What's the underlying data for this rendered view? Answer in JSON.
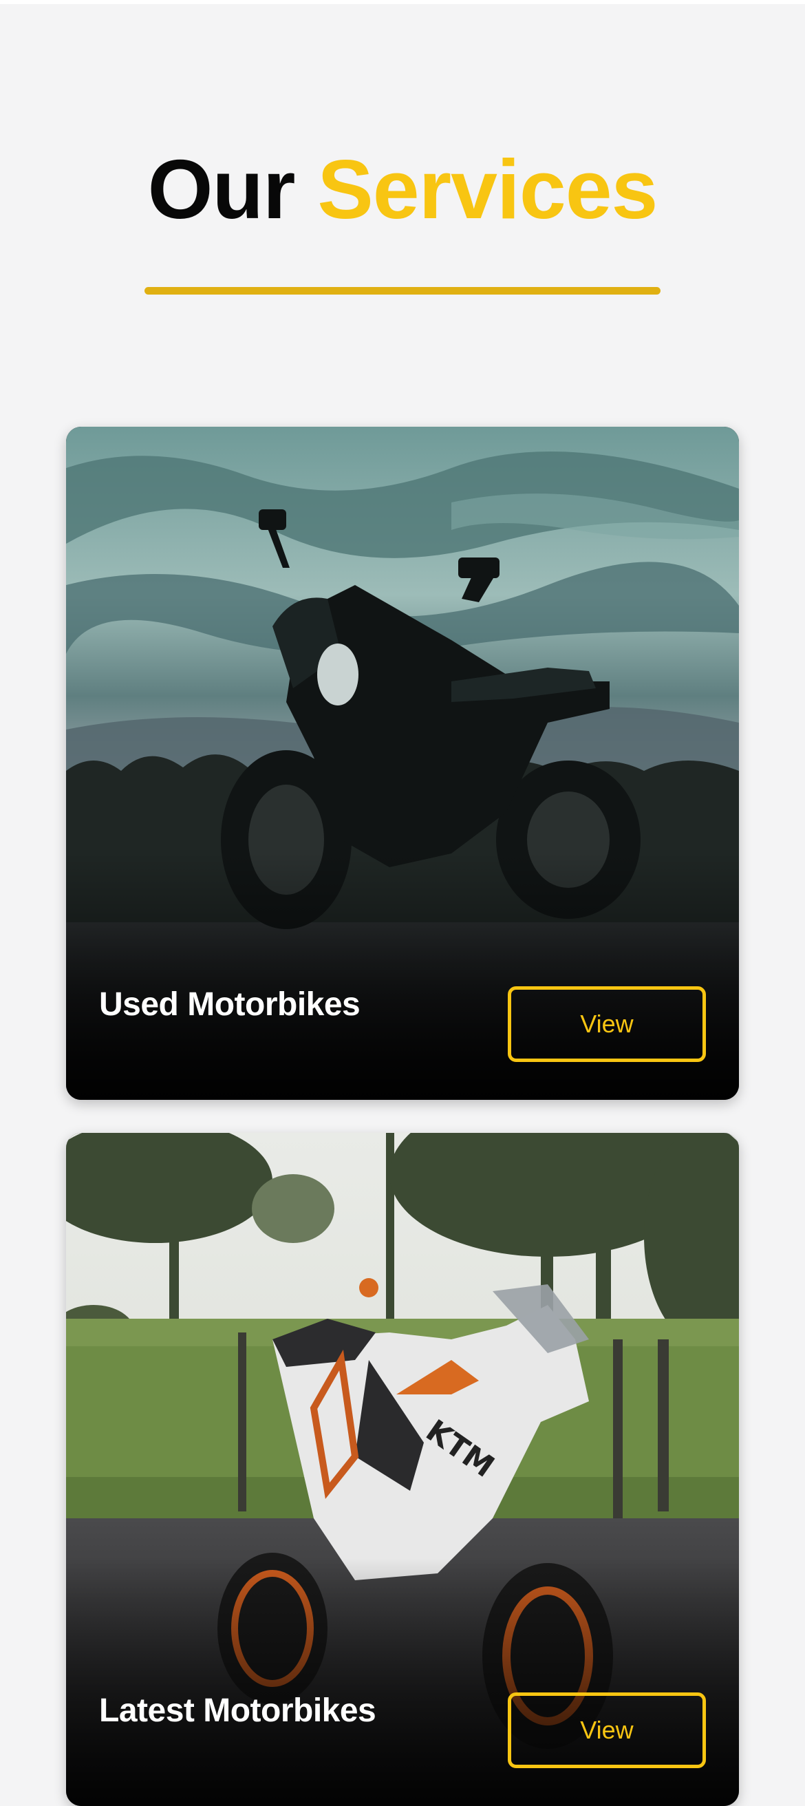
{
  "header": {
    "title_part1": "Our",
    "title_part2": "Services"
  },
  "services": [
    {
      "title": "Used Motorbikes",
      "button_label": "View",
      "image": "dark-naked-motorcycle-cloudy-sky-photo"
    },
    {
      "title": "Latest Motorbikes",
      "button_label": "View",
      "image": "white-orange-ktm-sport-motorcycle-photo"
    }
  ],
  "colors": {
    "background": "#f4f4f5",
    "accent": "#f8c512",
    "underline": "#e0b012",
    "heading": "#080808",
    "card_text": "#ffffff"
  }
}
